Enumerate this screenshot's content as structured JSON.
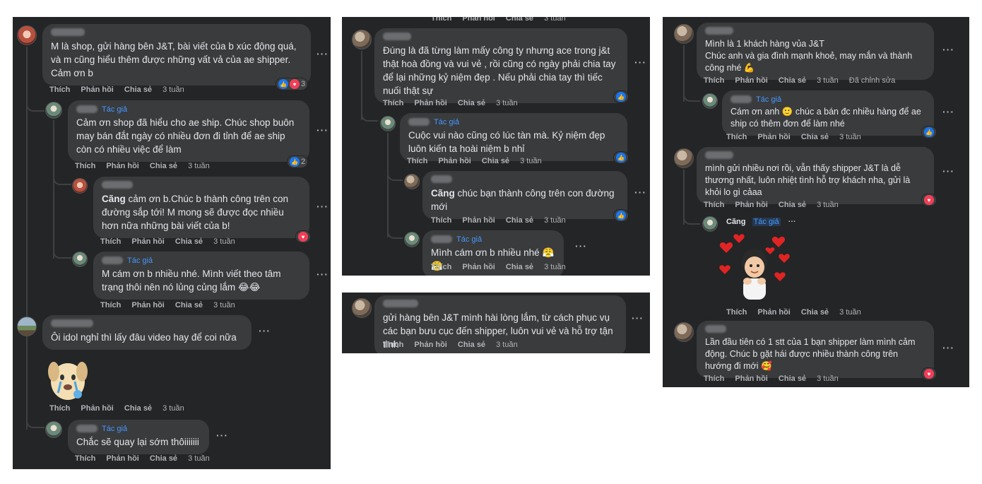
{
  "common": {
    "like": "Thích",
    "reply": "Phản hồi",
    "share": "Chia sẻ",
    "author": "Tác giả",
    "time": "3 tuần",
    "edited": "Đã chỉnh sửa",
    "more": "···"
  },
  "panel1": {
    "c1": {
      "text": "M là shop, gửi hàng bên J&T, bài viết của b xúc động quá, và m cũng hiểu thêm được những vất vả của ae shipper. Cảm ơn b",
      "react_count": "3"
    },
    "c2": {
      "text": "Cảm ơn shop đã hiểu cho ae ship. Chúc shop buôn may bán đắt ngày có nhiều đơn đi tỉnh để ae ship còn có nhiều việc để làm",
      "react_count": "2"
    },
    "c3": {
      "bold": "Cãng",
      "text": " cảm ơn b.Chúc b thành công trên con đường sắp tới! M mong sẽ được đọc nhiều hơn nữa những bài viết của b!"
    },
    "c4": {
      "text": "M cám ơn b nhiều nhé. Mình viết theo tâm trạng thôi nên nó lủng củng lắm 😂😂"
    },
    "c5": {
      "text": "Ôi idol nghỉ thì lấy đâu video hay để coi nữa"
    },
    "c6": {
      "text": "Chắc sẽ quay lại sớm thôiiiiiii"
    }
  },
  "panel2": {
    "c1": {
      "text": "Đúng là đã từng làm mấy công ty nhưng ace trong j&t thật hoà đồng và vui vẻ , rồi cũng có ngày phải chia tay để lại những kỷ niệm đẹp . Nếu phải chia tay thì tiếc nuối thật sự"
    },
    "c2": {
      "text": "Cuộc vui nào cũng có lúc tàn mà. Kỷ niệm đẹp luôn kiến ta hoài niệm b nhỉ"
    },
    "c3": {
      "bold": "Cãng",
      "text": " chúc bạn thành công trên con đường mới"
    },
    "c4": {
      "text": "Mình cám ơn b nhiều nhé 😤😤"
    }
  },
  "panel3": {
    "c1": {
      "text": "gửi hàng bên J&T mình hài lòng lắm, từ cách phục vụ các bạn bưu cục đến shipper, luôn vui vẻ và hỗ trợ tận tình"
    }
  },
  "panel4": {
    "c1": {
      "text": "Mình là 1 khách hàng vủa J&T\nChúc anh và gia đình mạnh khoẻ, may mắn và thành công nhé 💪"
    },
    "c2": {
      "text": "Cám ơn anh 🙂 chúc a bán đc nhiều hàng để ae ship có thêm đơn để làm nhé"
    },
    "c3": {
      "text": "mình gửi nhiều nơi rồi, vẫn thấy shipper J&T là dễ thương nhất, luôn nhiệt tình hỗ trợ khách nha, gửi là khỏi lo gì cảaa"
    },
    "c4": {
      "name": "Cãng"
    },
    "c5": {
      "text": "Lần đầu tiên có 1 stt của 1 bạn shipper làm mình cảm động. Chúc b gặt hái được nhiều thành công trên hướng đi mới 🥰"
    }
  }
}
